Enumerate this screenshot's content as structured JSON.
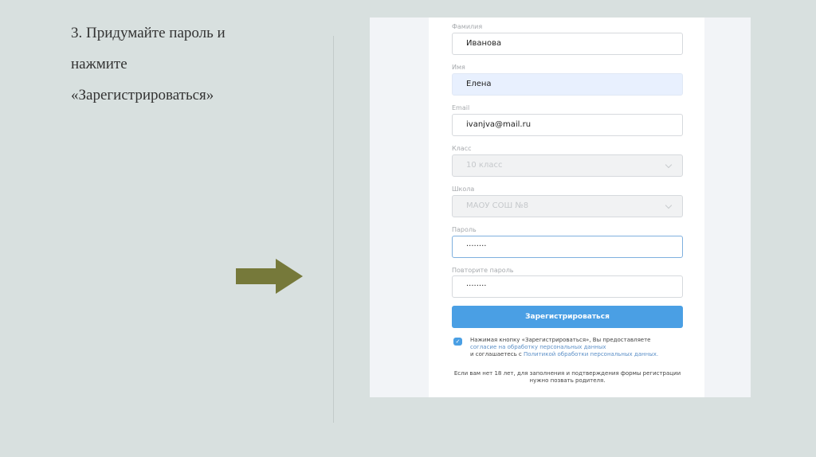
{
  "instruction": {
    "line1": "3. Придумайте пароль и",
    "line2": "нажмите",
    "line3": "«Зарегистрироваться»"
  },
  "form": {
    "last_name": {
      "label": "Фамилия",
      "value": "Иванова"
    },
    "first_name": {
      "label": "Имя",
      "value": "Елена"
    },
    "email": {
      "label": "Email",
      "value": "ivanjva@mail.ru"
    },
    "grade": {
      "label": "Класс",
      "value": "10 класс"
    },
    "school": {
      "label": "Школа",
      "value": "МАОУ СОШ №8"
    },
    "password": {
      "label": "Пароль",
      "value": "········"
    },
    "password_repeat": {
      "label": "Повторите пароль",
      "value": "········"
    },
    "submit": "Зарегистрироваться",
    "consent": {
      "text1": "Нажимая кнопку «Зарегистрироваться», Вы предоставляете",
      "link1": "согласие на  обработку персональных данных",
      "text2": "и соглашаетесь с ",
      "link2": "Политикой обработки персональных данных."
    },
    "footer": "Если вам нет 18 лет, для заполнения и подтверждения формы регистрации нужно позвать родителя."
  },
  "colors": {
    "accent": "#4a9fe4",
    "arrow": "#76793a",
    "background": "#d8e0df"
  }
}
